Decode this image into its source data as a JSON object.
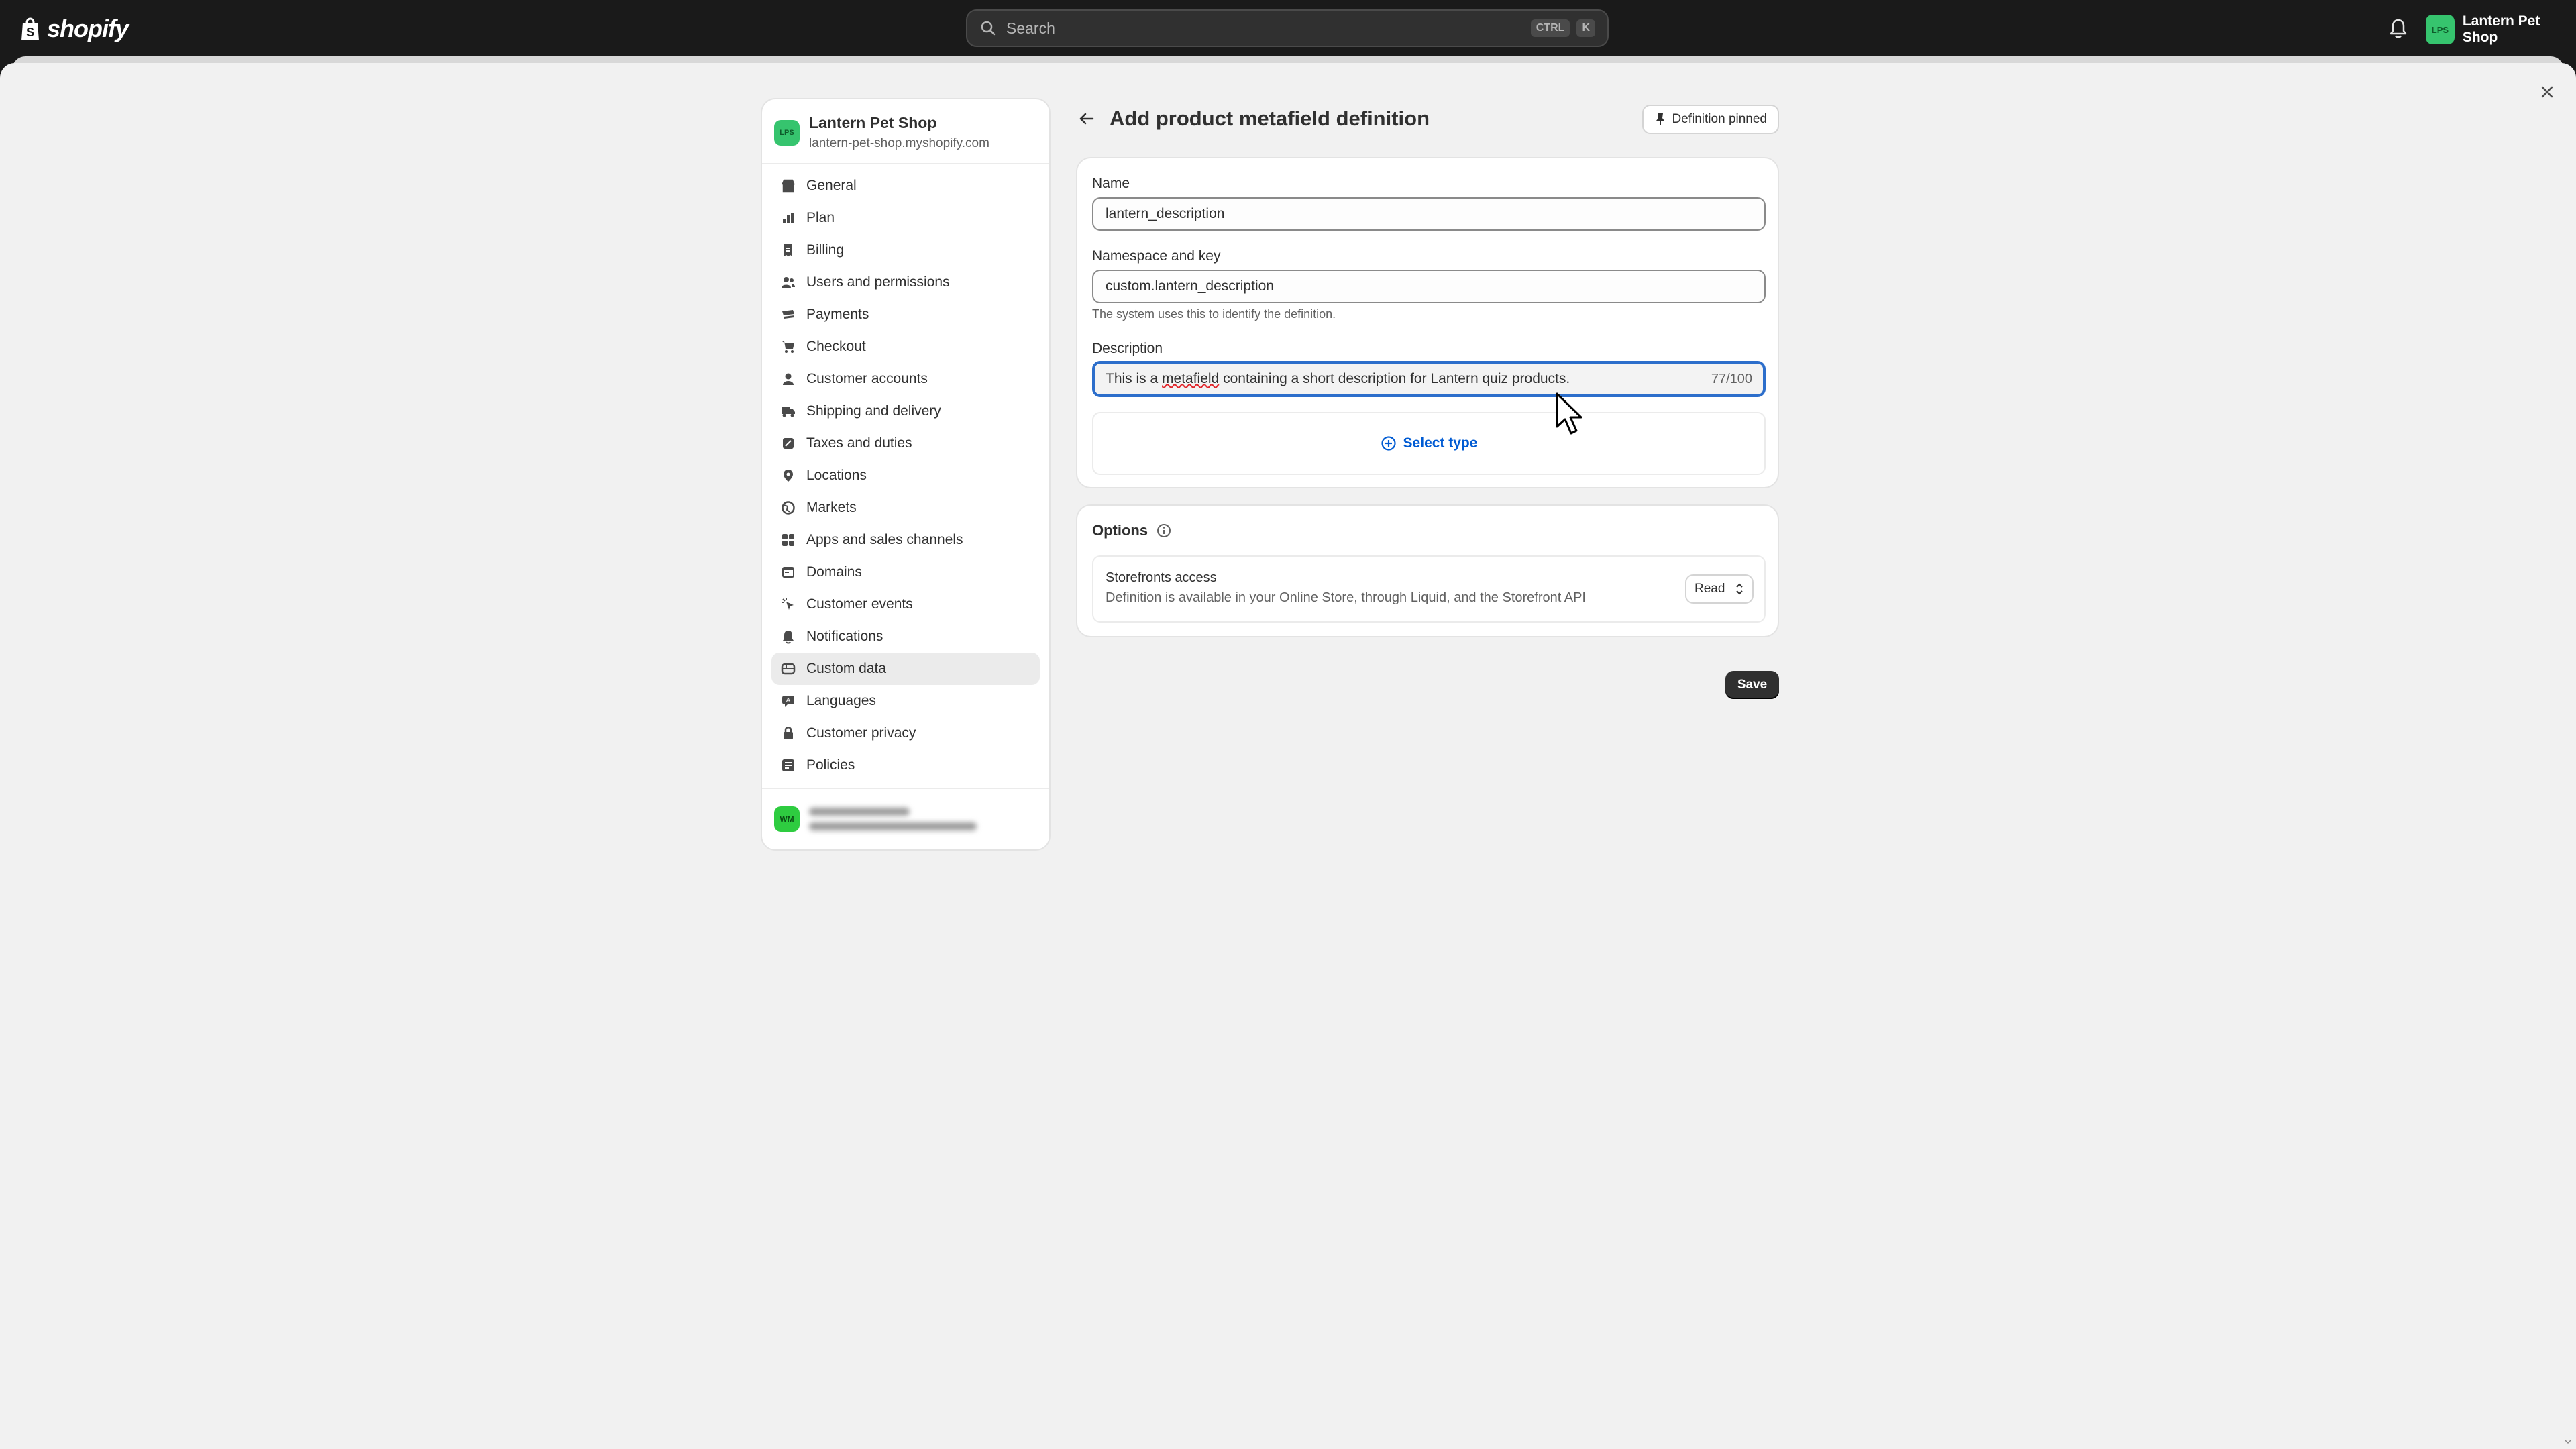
{
  "topbar": {
    "logo_text": "shopify",
    "search_placeholder": "Search",
    "shortcut_keys": [
      "CTRL",
      "K"
    ],
    "store_initials": "LPS",
    "store_name": "Lantern Pet Shop"
  },
  "nav": {
    "shop_initials": "LPS",
    "shop_name": "Lantern Pet Shop",
    "shop_url": "lantern-pet-shop.myshopify.com",
    "items": [
      {
        "label": "General",
        "icon": "store-icon"
      },
      {
        "label": "Plan",
        "icon": "plan-icon"
      },
      {
        "label": "Billing",
        "icon": "billing-icon"
      },
      {
        "label": "Users and permissions",
        "icon": "users-icon"
      },
      {
        "label": "Payments",
        "icon": "payments-icon"
      },
      {
        "label": "Checkout",
        "icon": "cart-icon"
      },
      {
        "label": "Customer accounts",
        "icon": "person-icon"
      },
      {
        "label": "Shipping and delivery",
        "icon": "truck-icon"
      },
      {
        "label": "Taxes and duties",
        "icon": "taxes-icon"
      },
      {
        "label": "Locations",
        "icon": "location-icon"
      },
      {
        "label": "Markets",
        "icon": "globe-icon"
      },
      {
        "label": "Apps and sales channels",
        "icon": "apps-icon"
      },
      {
        "label": "Domains",
        "icon": "domains-icon"
      },
      {
        "label": "Customer events",
        "icon": "cursor-click-icon"
      },
      {
        "label": "Notifications",
        "icon": "bell-icon"
      },
      {
        "label": "Custom data",
        "icon": "database-icon",
        "active": true
      },
      {
        "label": "Languages",
        "icon": "languages-icon"
      },
      {
        "label": "Customer privacy",
        "icon": "lock-icon"
      },
      {
        "label": "Policies",
        "icon": "policies-icon"
      }
    ],
    "user_initials": "WM"
  },
  "page": {
    "title": "Add product metafield definition",
    "pin_label": "Definition pinned"
  },
  "form": {
    "name_label": "Name",
    "name_value": "lantern_description",
    "namespace_label": "Namespace and key",
    "namespace_value": "custom.lantern_description",
    "namespace_help": "The system uses this to identify the definition.",
    "description_label": "Description",
    "description_before": "This is a ",
    "description_misspelled": "metafield",
    "description_after": " containing a short description for Lantern quiz products.",
    "description_counter": "77/100",
    "select_type_label": "Select type"
  },
  "options": {
    "title": "Options",
    "storefront_title": "Storefronts access",
    "storefront_desc": "Definition is available in your Online Store, through Liquid, and the Storefront API",
    "access_value": "Read"
  },
  "actions": {
    "save_label": "Save"
  },
  "colors": {
    "topbar": "#1a1a1a",
    "accent_blue": "#005bd3",
    "focus_ring": "#2c6ecb",
    "avatar_green": "#36c46e",
    "primary_button": "#303030"
  }
}
